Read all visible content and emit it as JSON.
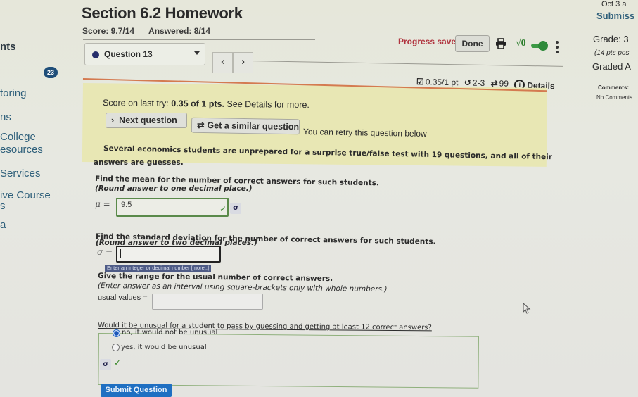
{
  "sidebar": {
    "items": [
      {
        "label": "nts",
        "style": "dark"
      },
      {
        "label": "toring"
      },
      {
        "label": "ns"
      },
      {
        "label": "College"
      },
      {
        "label": "esources"
      },
      {
        "label": "Services"
      },
      {
        "label": "ive Course"
      },
      {
        "label": "s"
      },
      {
        "label": "a"
      }
    ],
    "badge_count": "23"
  },
  "header": {
    "title": "Section 6.2 Homework",
    "score": "Score: 9.7/14",
    "answered": "Answered: 8/14",
    "question_select": "Question 13",
    "prev_label": "‹",
    "next_label": "›",
    "progress_status": "Progress saved",
    "done_label": "Done",
    "sqrt_label": "√0",
    "meta": {
      "points": "0.35/1 pt",
      "attempts": "2-3",
      "retries": "99",
      "details_label": "Details"
    }
  },
  "right_panel": {
    "date": "Oct 3 a",
    "submission": "Submiss",
    "grade": "Grade: 3",
    "points_possible": "(14 pts pos",
    "graded": "Graded A",
    "comments_label": "Comments:",
    "comments_value": "No Comments"
  },
  "feedback": {
    "last_try_prefix": "Score on last try: ",
    "last_try_score": "0.35 of 1 pts.",
    "last_try_suffix": " See Details for more.",
    "next_question_label": "Next question",
    "similar_question_label": "Get a similar question",
    "retry_message": "You can retry this question below"
  },
  "question": {
    "intro_line1": "Several economics students are unprepared for a surprise true/false test with 19 questions, and all of their",
    "intro_line2": "answers are guesses.",
    "parts": {
      "mean": {
        "prompt": "Find the mean for the number of correct answers for such students.",
        "instruction": "(Round answer to one decimal place.)",
        "symbol": "μ =",
        "value": "9.5",
        "status": "correct"
      },
      "sd": {
        "prompt": "Find the standard deviation for the number of correct answers for such students.",
        "instruction": "(Round answer to two decimal places.)",
        "symbol": "σ =",
        "value": "",
        "tooltip": "Enter an integer or decimal number [more..]"
      },
      "range": {
        "prompt": "Give the range for the usual number of correct answers.",
        "instruction": "(Enter answer as an interval using square-brackets only with whole numbers.)",
        "label": "usual values =",
        "value": ""
      },
      "unusual": {
        "prompt": "Would it be unusual for a student to pass by guessing and getting at least 12 correct answers?",
        "options": [
          {
            "label": "no, it would not be unusual",
            "selected": true
          },
          {
            "label": "yes, it would be unusual",
            "selected": false
          }
        ],
        "status": "correct"
      }
    },
    "submit_label": "Submit Question"
  },
  "colors": {
    "progress_saved": "#b0343f",
    "correct": "#3c8a2e",
    "submit": "#1f6fc2",
    "feedback_bg": "#e8e7b4",
    "badge": "#1f4e79"
  }
}
